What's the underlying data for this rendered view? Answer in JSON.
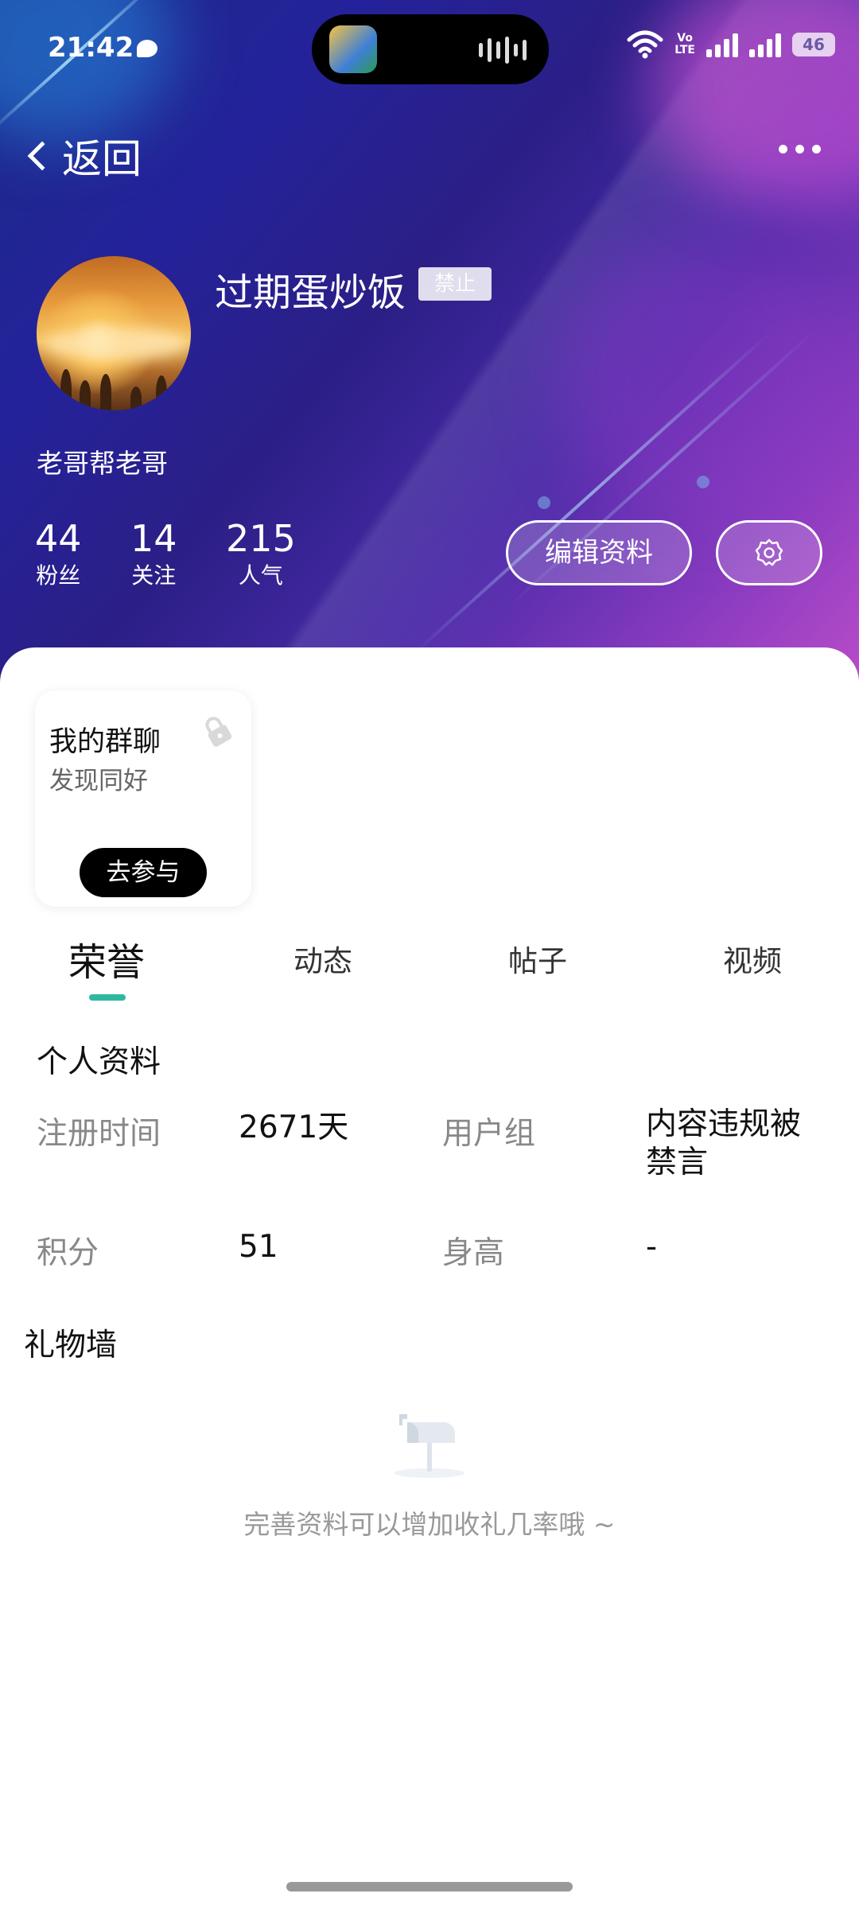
{
  "status_bar": {
    "time": "21:42",
    "volte": "Vo\nLTE",
    "battery": "46"
  },
  "nav": {
    "back_label": "返回"
  },
  "profile": {
    "username": "过期蛋炒饭",
    "ban_badge": "禁止",
    "bio": "老哥帮老哥",
    "stats": [
      {
        "num": "44",
        "label": "粉丝"
      },
      {
        "num": "14",
        "label": "关注"
      },
      {
        "num": "215",
        "label": "人气"
      }
    ],
    "edit_label": "编辑资料"
  },
  "group_card": {
    "title": "我的群聊",
    "subtitle": "发现同好",
    "join_label": "去参与"
  },
  "tabs": [
    "荣誉",
    "动态",
    "帖子",
    "视频"
  ],
  "info": {
    "title": "个人资料",
    "fields": [
      {
        "label": "注册时间",
        "value": "2671天"
      },
      {
        "label": "用户组",
        "value": "内容违规被\n禁言"
      },
      {
        "label": "积分",
        "value": "51"
      },
      {
        "label": "身高",
        "value": "-"
      }
    ]
  },
  "gift_wall": {
    "title": "礼物墙",
    "empty_text": "完善资料可以增加收礼几率哦 ~"
  },
  "colors": {
    "accent_tab": "#2fb8a0",
    "hero_start": "#1b2a8a",
    "hero_end": "#b84cc9"
  }
}
